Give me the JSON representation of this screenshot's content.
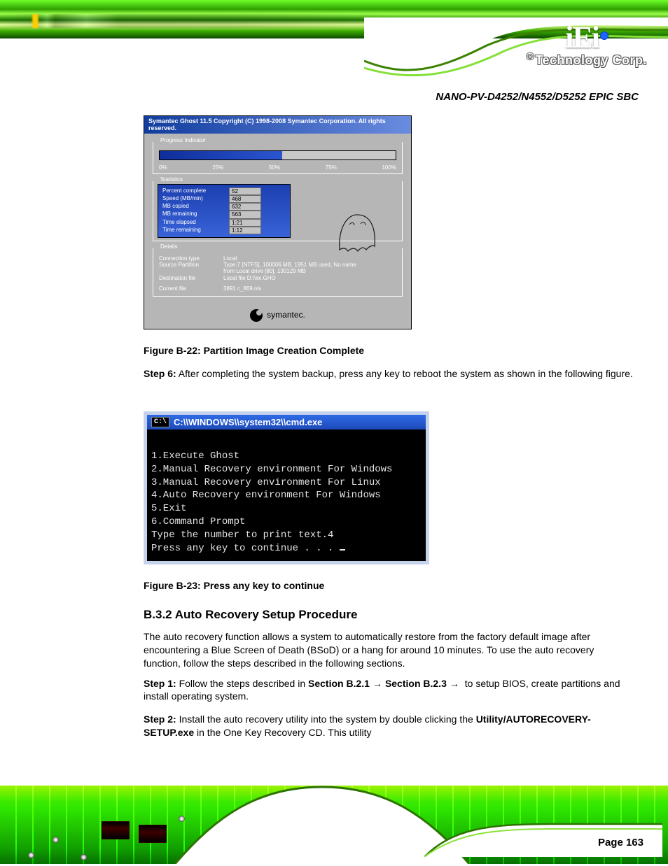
{
  "brand": {
    "logo_text": "iEi",
    "subtitle": "Technology Corp.",
    "registered": "®"
  },
  "product_name": "NANO-PV-D4252/N4552/D5252 EPIC SBC",
  "ghost": {
    "window_title": "Symantec Ghost 11.5   Copyright (C) 1998-2008 Symantec Corporation. All rights reserved.",
    "progress_label": "Progress Indicator",
    "ticks": [
      "0%",
      "25%",
      "50%",
      "75%",
      "100%"
    ],
    "progress_percent": 52,
    "statistics_label": "Statistics",
    "stats": [
      {
        "label": "Percent complete",
        "value": "52"
      },
      {
        "label": "Speed (MB/min)",
        "value": "468"
      },
      {
        "label": "MB copied",
        "value": "632"
      },
      {
        "label": "MB remaining",
        "value": "563"
      },
      {
        "label": "Time elapsed",
        "value": "1:21"
      },
      {
        "label": "Time remaining",
        "value": "1:12"
      }
    ],
    "details_label": "Details",
    "details": [
      {
        "label": "Connection type",
        "value": "Local"
      },
      {
        "label": "Source Partition",
        "value": "Type:7 [NTFS], 100006 MB, 1951 MB used, No name"
      },
      {
        "label": "",
        "value": "from Local drive [80], 130129 MB"
      },
      {
        "label": "Destination file",
        "value": "Local file D:\\\\iei.GHO"
      },
      {
        "label": "Current file",
        "value": "3891 c_869.nls"
      }
    ],
    "footer_brand": "symantec."
  },
  "figure22_caption": "Figure B-22: Partition Image Creation Complete",
  "step6_lead": "Step 6:",
  "step6_text": " After completing the system backup, press any key to reboot the system as shown in the following figure.",
  "cmd": {
    "title": "C:\\\\WINDOWS\\\\system32\\\\cmd.exe",
    "lines": [
      "",
      "1.Execute Ghost",
      "2.Manual Recovery environment For Windows",
      "3.Manual Recovery environment For Linux",
      "4.Auto Recovery environment For Windows",
      "5.Exit",
      "6.Command Prompt",
      "Type the number to print text.4",
      "Press any key to continue . . . "
    ]
  },
  "figure23_caption": "Figure B-23: Press any key to continue",
  "subsection_title": "B.3.2 Auto Recovery Setup Procedure",
  "intro_text": "The auto recovery function allows a system to automatically restore from the factory default image after encountering a Blue Screen of Death (BSoD) or a hang for around 10 minutes. To use the auto recovery function, follow the steps described in the following sections.",
  "stepA1_lead": "Step 1:",
  "stepA1_text": " Follow the steps described in ",
  "secref1": "Section B.2.1",
  "stepA1_mid": " ~ ",
  "secref2": "Section B.2.3",
  "stepA1_tail": " to setup BIOS, create partitions and install operating system.",
  "stepA2_lead": "Step 2:",
  "stepA2_text": " Install the auto recovery utility into the system by double clicking the ",
  "utility_name": "Utility/AUTORECOVERY-SETUP.exe",
  "stepA2_tail": " in the One Key Recovery CD. This utility",
  "page_label_prefix": "Page ",
  "page_number": "163"
}
